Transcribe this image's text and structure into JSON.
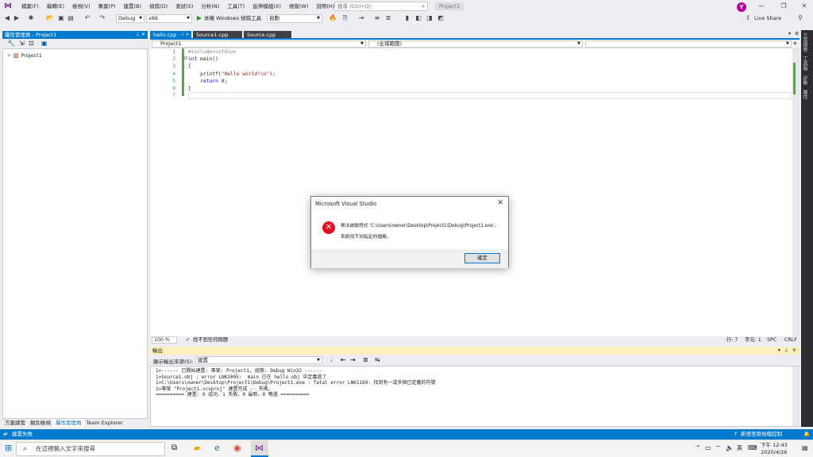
{
  "menu": {
    "items": [
      "檔案(F)",
      "編輯(E)",
      "檢視(V)",
      "專案(P)",
      "建置(B)",
      "偵錯(D)",
      "測試(S)",
      "分析(N)",
      "工具(T)",
      "延伸模組(X)",
      "視窗(W)",
      "說明(H)"
    ],
    "search_placeholder": "搜尋 (Ctrl+Q)",
    "solution_name": "Project1",
    "avatar_letter": "Y",
    "live_share": "Live Share"
  },
  "toolbar": {
    "config": "Debug",
    "platform": "x86",
    "debugger": "本機 Windows 偵錯工具",
    "debugger_mode": "自動"
  },
  "left_panel": {
    "title": "屬性管理員 - Project1",
    "tree_item": "Project1",
    "bottom_tabs": [
      "方案總管",
      "類別檢視",
      "屬性管理員",
      "Team Explorer"
    ]
  },
  "editor": {
    "tabs": [
      "hello.cpp",
      "Source1.cpp",
      "Source.cpp"
    ],
    "active_tab": "hello.cpp",
    "nav_project": "Project1",
    "nav_scope": "(全域範圍)",
    "line_numbers": [
      "1",
      "2",
      "3",
      "4",
      "5",
      "6",
      "7"
    ],
    "code": {
      "l1_pp": "#include<cstdio>",
      "l2_kw": "int",
      "l2_rest": " main()",
      "l3": "{",
      "l4_a": "    printf(",
      "l4_str": "\"Hello world!\\n\"",
      "l4_b": ");",
      "l5_kw": "    return",
      "l5_rest": " 0;",
      "l6": "}"
    },
    "zoom": "100 %",
    "issues": "找不到任何問題",
    "line": "行: 7",
    "col": "字元: 1",
    "spc": "SPC",
    "crlf": "CRLF"
  },
  "output": {
    "title": "輸出",
    "show_from_label": "顯示輸出來源(S):",
    "show_from_value": "建置",
    "lines": [
      "1>------ 已開始建置: 專案: Project1, 組態: Debug Win32 ------",
      "1>Source1.obj : error LNK2005: _main 已在 hello.obj 中定義過了",
      "1>C:\\Users\\owner\\Desktop\\Project1\\Debug\\Project1.exe : fatal error LNK1169: 找到有一或多個已定義的符號",
      "1>專案 \"Project1.vcxproj\" 建置完成 -- 失敗。",
      "========== 建置: 0 成功、1 失敗、0 最新、0 略過 =========="
    ]
  },
  "right_tabs": [
    "方案總管",
    "工具箱",
    "診斷",
    "屬性"
  ],
  "statusbar": {
    "left": "建置失敗",
    "right": "新增至原始檔控制"
  },
  "taskbar": {
    "search_placeholder": "在這裡輸入文字來搜尋",
    "time": "下午 12:43",
    "date": "2020/4/26"
  },
  "dialog": {
    "title": "Microsoft Visual Studio",
    "line1": "無法啟動程式 'C:\\Users\\owner\\Desktop\\Project1\\Debug\\Project1.exe'。",
    "line2": "系統找不到指定的檔案。",
    "ok_label": "確定"
  },
  "colors": {
    "accent": "#007acc",
    "error": "#e81123",
    "vs_purple": "#68217a"
  }
}
